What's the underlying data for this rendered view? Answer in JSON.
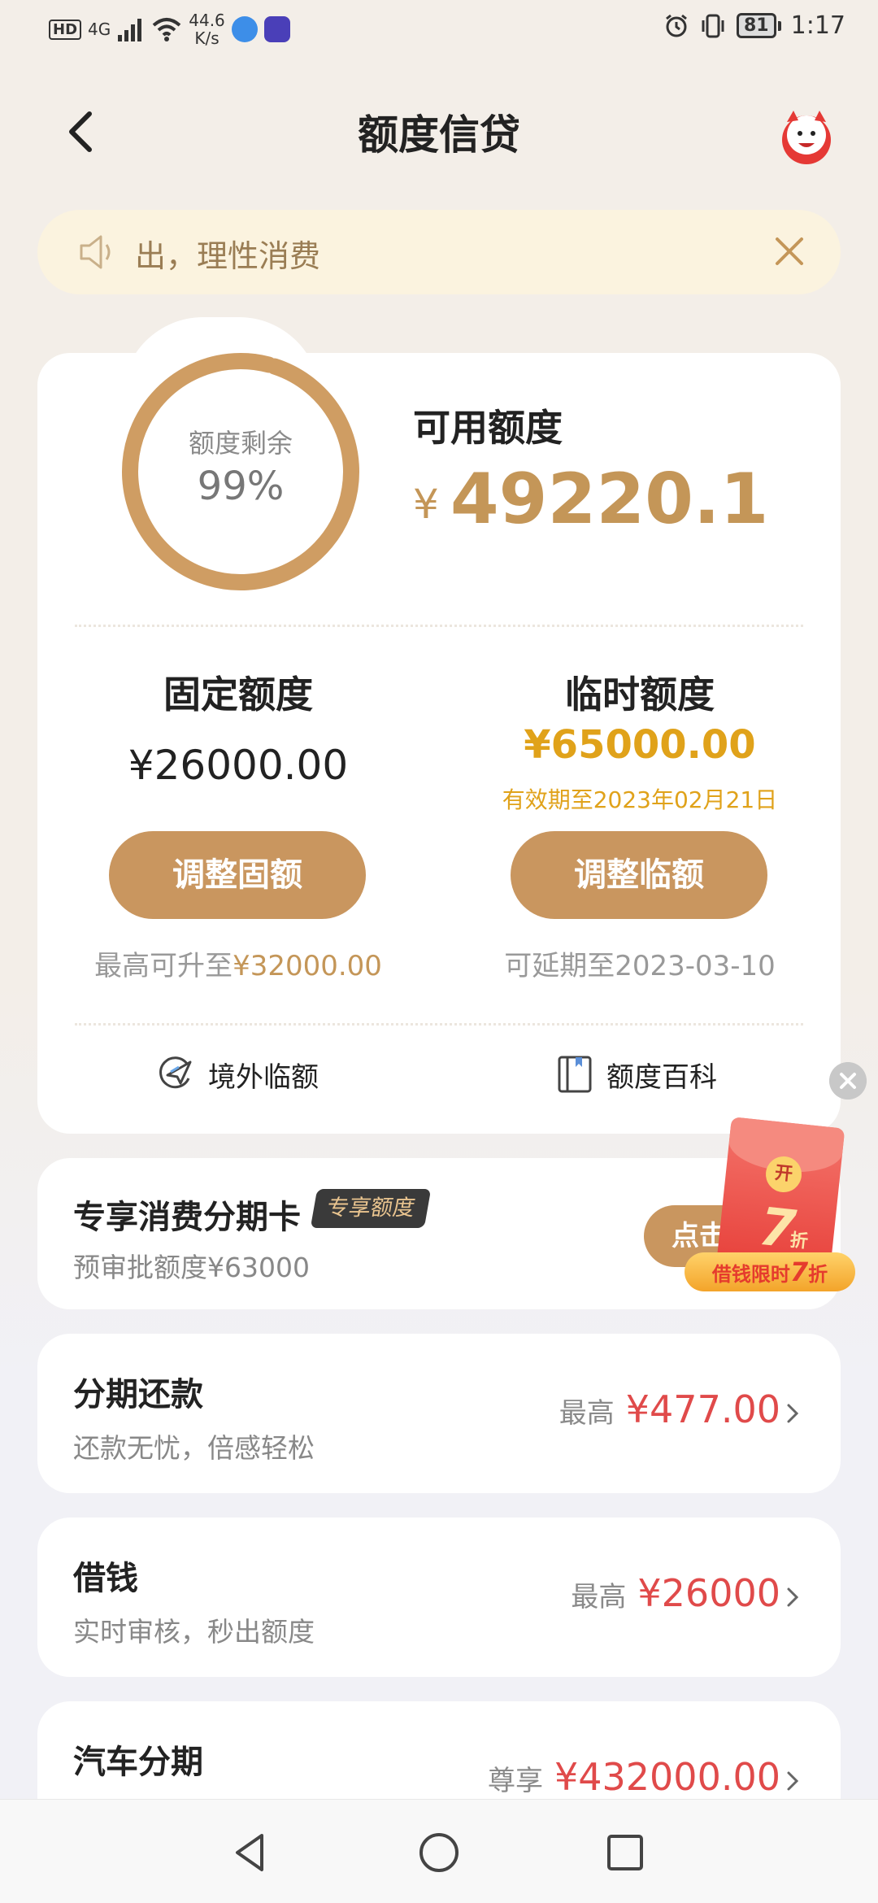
{
  "status_bar": {
    "network": "4G",
    "speed": "44.6",
    "speed_unit": "K/s",
    "battery": "81",
    "time": "1:17"
  },
  "header": {
    "title": "额度信贷"
  },
  "notice": {
    "text": "出，理性消费"
  },
  "credit": {
    "ring_label": "额度剩余",
    "ring_value": "99%",
    "remaining_fraction": 0.99,
    "available_label": "可用额度",
    "available_currency": "¥",
    "available_amount": "49220.1"
  },
  "fixed": {
    "title": "固定额度",
    "amount": "¥26000.00",
    "button": "调整固额",
    "note_prefix": "最高可升至",
    "note_amount": "¥32000.00"
  },
  "temporary": {
    "title": "临时额度",
    "amount": "¥65000.00",
    "validity": "有效期至2023年02月21日",
    "button": "调整临额",
    "note": "可延期至2023-03-10"
  },
  "links": {
    "overseas": "境外临额",
    "wiki": "额度百科"
  },
  "installment_card": {
    "title": "专享消费分期卡",
    "badge": "专享额度",
    "subtitle": "预审批额度¥63000",
    "button": "点击"
  },
  "promo": {
    "coin": "开",
    "big": "7",
    "small": "折",
    "ribbon_prefix": "借钱限时",
    "ribbon_num": "7",
    "ribbon_suffix": "折"
  },
  "services": [
    {
      "title": "分期还款",
      "subtitle": "还款无忧，倍感轻松",
      "prefix": "最高",
      "amount": "¥477.00"
    },
    {
      "title": "借钱",
      "subtitle": "实时审核，秒出额度",
      "prefix": "最高",
      "amount": "¥26000"
    },
    {
      "title": "汽车分期",
      "subtitle": "",
      "prefix": "尊享",
      "amount": "¥432000.00"
    }
  ],
  "colors": {
    "accent": "#c9965f",
    "gold": "#c49658",
    "temp_yellow": "#e0a21a",
    "red": "#e04a4a",
    "notice_bg": "#fbf3df"
  }
}
